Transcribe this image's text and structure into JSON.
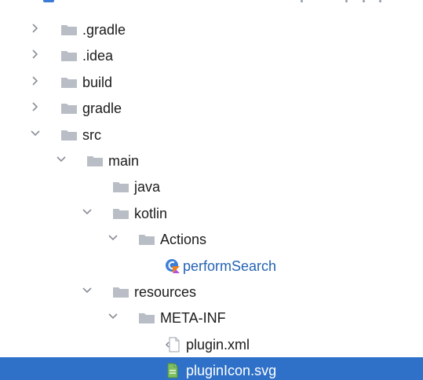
{
  "tree": {
    "nodes": [
      {
        "label": ".gradle",
        "kind": "folder",
        "expanded": false,
        "has_chevron": true,
        "level": 0
      },
      {
        "label": ".idea",
        "kind": "folder",
        "expanded": false,
        "has_chevron": true,
        "level": 0
      },
      {
        "label": "build",
        "kind": "folder",
        "expanded": false,
        "has_chevron": true,
        "level": 0
      },
      {
        "label": "gradle",
        "kind": "folder",
        "expanded": false,
        "has_chevron": true,
        "level": 0
      },
      {
        "label": "src",
        "kind": "folder",
        "expanded": true,
        "has_chevron": true,
        "level": 0
      },
      {
        "label": "main",
        "kind": "folder",
        "expanded": true,
        "has_chevron": true,
        "level": 1
      },
      {
        "label": "java",
        "kind": "folder",
        "expanded": false,
        "has_chevron": false,
        "level": 2
      },
      {
        "label": "kotlin",
        "kind": "folder",
        "expanded": true,
        "has_chevron": true,
        "level": 2
      },
      {
        "label": "Actions",
        "kind": "folder",
        "expanded": true,
        "has_chevron": true,
        "level": 3
      },
      {
        "label": "performSearch",
        "kind": "kotlin-file",
        "expanded": false,
        "has_chevron": false,
        "level": 4
      },
      {
        "label": "resources",
        "kind": "folder",
        "expanded": true,
        "has_chevron": true,
        "level": 2
      },
      {
        "label": "META-INF",
        "kind": "folder",
        "expanded": true,
        "has_chevron": true,
        "level": 3
      },
      {
        "label": "plugin.xml",
        "kind": "xml-file",
        "expanded": false,
        "has_chevron": false,
        "level": 4
      },
      {
        "label": "pluginIcon.svg",
        "kind": "svg-file",
        "expanded": false,
        "has_chevron": false,
        "level": 4,
        "selected": true
      }
    ]
  },
  "colors": {
    "folder": "#b9bec6",
    "chevron": "#8a8f96",
    "selection": "#2f71c8",
    "kotlin_text": "#2463b4"
  }
}
